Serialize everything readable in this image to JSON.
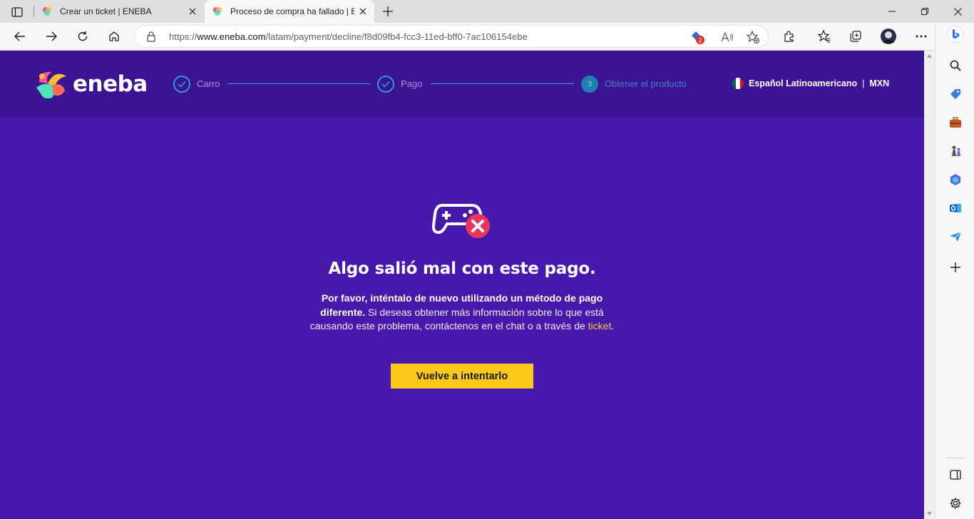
{
  "browser": {
    "tabs": [
      {
        "title": "Crear un ticket | ENEBA",
        "active": false
      },
      {
        "title": "Proceso de compra ha fallado | E",
        "active": true
      }
    ],
    "url": {
      "scheme": "https://",
      "host": "www.eneba.com",
      "path": "/latam/payment/decline/f8d09fb4-fcc3-11ed-bff0-7ac106154ebe"
    },
    "extension_badge": "2"
  },
  "site": {
    "logo_text": "eneba",
    "steps": [
      {
        "label": "Carro",
        "state": "done"
      },
      {
        "label": "Pago",
        "state": "done"
      },
      {
        "number": "3",
        "label": "Obtener el producto",
        "state": "pending"
      }
    ],
    "locale": {
      "language": "Español Latinoamericano",
      "separator": "|",
      "currency": "MXN"
    }
  },
  "error": {
    "title": "Algo salió mal con este pago.",
    "text_bold": "Por favor, inténtalo de nuevo utilizando un método de pago diferente.",
    "text_rest": " Si deseas obtener más información sobre lo que está causando este problema, contáctenos en el chat o a través de ",
    "link_text": "ticket",
    "text_end": ".",
    "button_label": "Vuelve a intentarlo"
  },
  "colors": {
    "page_bg": "#4618ac",
    "header_bg": "#3a1495",
    "button_bg": "#fcc81a",
    "link": "#ffc83d",
    "error_badge": "#e8365a",
    "step_accent": "#2f9dc9"
  }
}
